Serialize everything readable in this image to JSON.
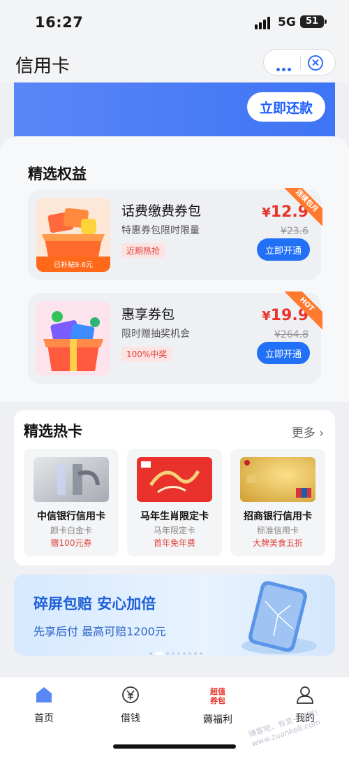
{
  "status": {
    "time": "16:27",
    "network": "5G",
    "battery": "51"
  },
  "nav": {
    "title": "信用卡"
  },
  "banner": {
    "repay_label": "立即还款"
  },
  "benefits": {
    "title": "精选权益",
    "items": [
      {
        "name": "话费缴费券包",
        "desc": "特惠券包限时限量",
        "tag": "近期热抢",
        "currency": "¥",
        "price": "12.9",
        "old_price": "¥23.6",
        "button": "立即开通",
        "ribbon": "连续包月",
        "thumb_label": "已补贴9.6元"
      },
      {
        "name": "惠享券包",
        "desc": "限时赠抽奖机会",
        "tag": "100%中奖",
        "currency": "¥",
        "price": "19.9",
        "old_price": "¥264.8",
        "button": "立即开通",
        "ribbon": "HOT"
      }
    ]
  },
  "hot_cards": {
    "title": "精选热卡",
    "more": "更多",
    "cards": [
      {
        "name": "中信银行信用卡",
        "sub": "颜卡白金卡",
        "benefit": "赠100元券"
      },
      {
        "name": "马年生肖限定卡",
        "sub": "马年限定卡",
        "benefit": "首年免年费"
      },
      {
        "name": "招商银行信用卡",
        "sub": "标准信用卡",
        "benefit": "大牌美食五折"
      }
    ]
  },
  "promo": {
    "title": "碎屏包赔 安心加倍",
    "subtitle": "先享后付 最高可赔1200元"
  },
  "tabbar": {
    "items": [
      {
        "label": "首页",
        "icon": "home-icon"
      },
      {
        "label": "借钱",
        "icon": "yuan-icon"
      },
      {
        "label": "薅福利",
        "icon": "super-coupon-icon",
        "icon_text": "超值券包"
      },
      {
        "label": "我的",
        "icon": "user-icon"
      }
    ]
  },
  "watermark": "赚客吧，有奖一起赚！www.zuanke8.com",
  "colors": {
    "primary": "#2270f6",
    "price_red": "#e8332b",
    "tag_red": "#e0433d"
  }
}
